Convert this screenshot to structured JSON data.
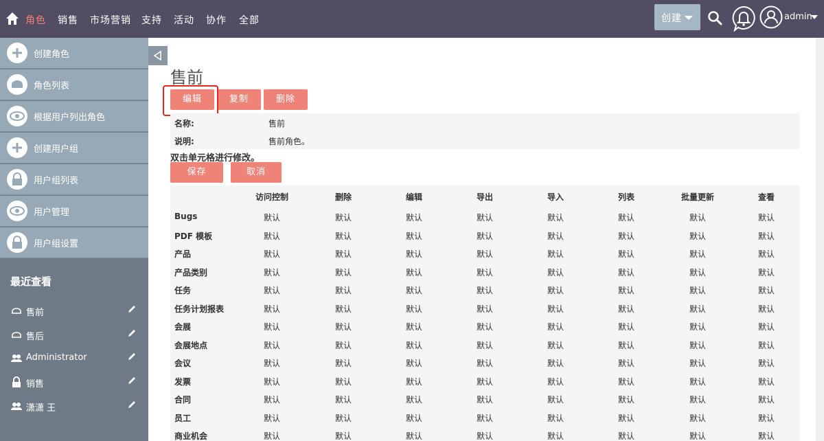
{
  "nav": {
    "items": [
      "角色",
      "销售",
      "市场营销",
      "支持",
      "活动",
      "协作",
      "全部"
    ],
    "create_label": "创建",
    "user_label": "admin"
  },
  "sidebar": {
    "actions": [
      "创建角色",
      "角色列表",
      "根据用户列出角色",
      "创建用户组",
      "用户组列表",
      "用户管理",
      "用户组设置"
    ],
    "recent_title": "最近查看",
    "recent": [
      "售前",
      "售后",
      "Administrator",
      "销售",
      "潇潇 王"
    ]
  },
  "page": {
    "title": "售前",
    "buttons": {
      "edit": "编辑",
      "copy": "复制",
      "delete": "删除"
    },
    "detail": {
      "name_label": "名称:",
      "name_value": "售前",
      "desc_label": "说明:",
      "desc_value": "售前角色。"
    },
    "hint": "双击单元格进行修改。",
    "save": "保存",
    "cancel": "取消"
  },
  "table": {
    "columns": [
      "访问控制",
      "删除",
      "编辑",
      "导出",
      "导入",
      "列表",
      "批量更新",
      "查看"
    ],
    "rows": [
      {
        "name": "Bugs",
        "cells": [
          "默认",
          "默认",
          "默认",
          "默认",
          "默认",
          "默认",
          "默认",
          "默认"
        ]
      },
      {
        "name": "PDF 模板",
        "cells": [
          "默认",
          "默认",
          "默认",
          "默认",
          "默认",
          "默认",
          "默认",
          "默认"
        ]
      },
      {
        "name": "产品",
        "cells": [
          "默认",
          "默认",
          "默认",
          "默认",
          "默认",
          "默认",
          "默认",
          "默认"
        ]
      },
      {
        "name": "产品类别",
        "cells": [
          "默认",
          "默认",
          "默认",
          "默认",
          "默认",
          "默认",
          "默认",
          "默认"
        ]
      },
      {
        "name": "任务",
        "cells": [
          "默认",
          "默认",
          "默认",
          "默认",
          "默认",
          "默认",
          "默认",
          "默认"
        ]
      },
      {
        "name": "任务计划报表",
        "cells": [
          "默认",
          "默认",
          "默认",
          "默认",
          "默认",
          "默认",
          "默认",
          "默认"
        ]
      },
      {
        "name": "会展",
        "cells": [
          "默认",
          "默认",
          "默认",
          "默认",
          "默认",
          "默认",
          "默认",
          "默认"
        ]
      },
      {
        "name": "会展地点",
        "cells": [
          "默认",
          "默认",
          "默认",
          "默认",
          "默认",
          "默认",
          "默认",
          "默认"
        ]
      },
      {
        "name": "会议",
        "cells": [
          "默认",
          "默认",
          "默认",
          "默认",
          "默认",
          "默认",
          "默认",
          "默认"
        ]
      },
      {
        "name": "发票",
        "cells": [
          "默认",
          "默认",
          "默认",
          "默认",
          "默认",
          "默认",
          "默认",
          "默认"
        ]
      },
      {
        "name": "合同",
        "cells": [
          "默认",
          "默认",
          "默认",
          "默认",
          "默认",
          "默认",
          "默认",
          "默认"
        ]
      },
      {
        "name": "员工",
        "cells": [
          "默认",
          "默认",
          "默认",
          "默认",
          "默认",
          "默认",
          "默认",
          "默认"
        ]
      },
      {
        "name": "商业机会",
        "cells": [
          "默认",
          "默认",
          "默认",
          "默认",
          "默认",
          "默认",
          "默认",
          "默认"
        ]
      }
    ]
  },
  "colors": {
    "navbar": "#534d64",
    "accent": "#f08377",
    "sidebar": "#6e7b87",
    "sidebar_action": "#97a9b6"
  }
}
